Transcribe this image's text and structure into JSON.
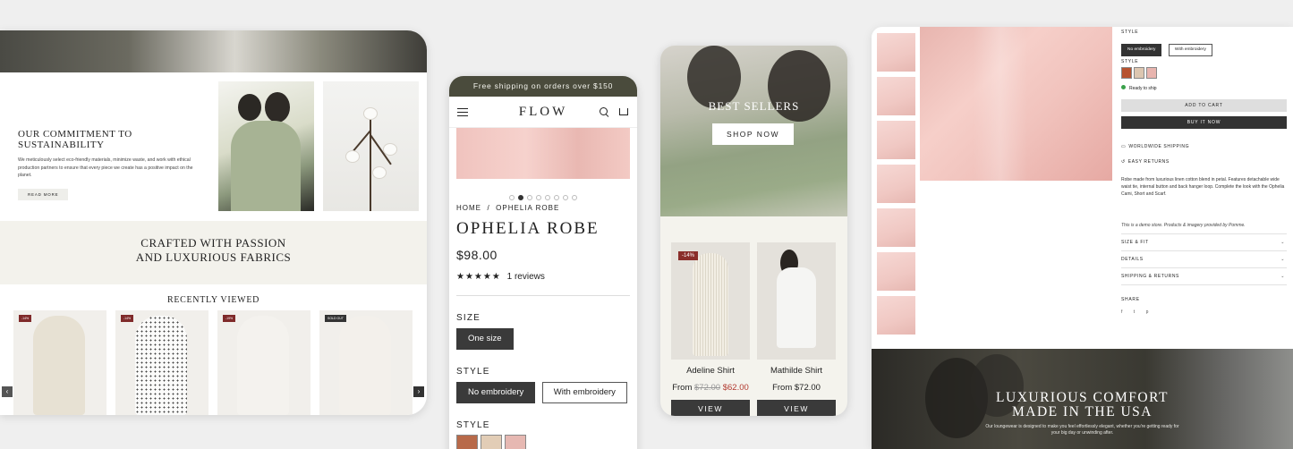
{
  "tablet": {
    "commitment": {
      "title": "OUR COMMITMENT TO SUSTAINABILITY",
      "body": "We meticulously select eco-friendly materials, minimize waste, and work with ethical production partners to ensure that every piece we create has a positive impact on the planet.",
      "button": "READ MORE"
    },
    "crafted": {
      "line1": "CRAFTED WITH PASSION",
      "line2": "AND LUXURIOUS FABRICS"
    },
    "recently_viewed": {
      "title": "RECENTLY VIEWED",
      "products": [
        {
          "badge": "-14%",
          "color": "#ece6d9"
        },
        {
          "badge": "-14%",
          "color": "#f3f2ef"
        },
        {
          "badge": "-19%",
          "color": "#efebe4"
        },
        {
          "badge": "SOLD OUT",
          "color": "#ece7df"
        }
      ],
      "prev_icon": "‹",
      "next_icon": "›"
    }
  },
  "phone_product": {
    "banner": "Free shipping on orders over $150",
    "logo": "FLOW",
    "breadcrumb": {
      "home": "HOME",
      "separator": "/",
      "current": "OPHELIA ROBE"
    },
    "title": "OPHELIA ROBE",
    "price": "$98.00",
    "stars": "★★★★★",
    "reviews": "1 reviews",
    "size_label": "SIZE",
    "size_option": "One size",
    "style_label": "STYLE",
    "style_options": [
      "No embroidery",
      "With embroidery"
    ],
    "style2_label": "STYLE",
    "swatches": [
      "#b86a4a",
      "#e2cdb6",
      "#e6b8b2"
    ],
    "carousel_dots": 8,
    "active_dot": 1
  },
  "phone_bestsellers": {
    "hero_title": "BEST SELLERS",
    "shop_button": "SHOP NOW",
    "discount_badge": "-14%",
    "products": [
      {
        "name": "Adeline Shirt",
        "from": "From",
        "old_price": "$72.00",
        "price": "$62.00",
        "button": "VIEW"
      },
      {
        "name": "Mathilde Shirt",
        "from": "From",
        "price": "$72.00",
        "button": "VIEW"
      }
    ]
  },
  "desktop_product": {
    "style_label": "STYLE",
    "style_options": [
      "No embroidery",
      "With embroidery"
    ],
    "style2_label": "STYLE",
    "swatches": [
      "#b7522f",
      "#dcc6b0",
      "#e8b4ae"
    ],
    "stock": "Ready to ship",
    "stock_color": "#3aa14a",
    "add_to_cart": "ADD TO CART",
    "buy_now": "BUY IT NOW",
    "features": [
      "WORLDWIDE SHIPPING",
      "EASY RETURNS"
    ],
    "description": "Robe made from luxurious linen cotton blend in petal. Features detachable wide waist tie, internal button and back hanger loop. Complete the look with the Ophelia Cami, Short and Scarf.",
    "demo_note": "This is a demo store. Products & imagery provided by Pomme.",
    "accordions": [
      "SIZE & FIT",
      "DETAILS",
      "SHIPPING & RETURNS"
    ],
    "share_label": "SHARE",
    "share_icons": [
      "f",
      "t",
      "p"
    ],
    "bottom_title": "LUXURIOUS COMFORT MADE IN THE USA",
    "bottom_sub": "Our loungewear is designed to make you feel effortlessly elegant, whether you're getting ready for your big day or unwinding after."
  }
}
